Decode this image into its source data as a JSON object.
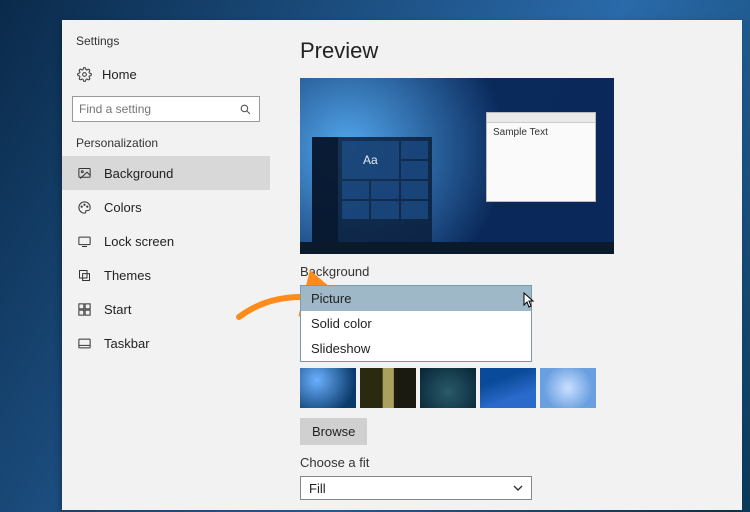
{
  "app_title": "Settings",
  "home_label": "Home",
  "search": {
    "placeholder": "Find a setting"
  },
  "section": "Personalization",
  "nav": [
    {
      "id": "background",
      "label": "Background",
      "selected": true
    },
    {
      "id": "colors",
      "label": "Colors",
      "selected": false
    },
    {
      "id": "lockscreen",
      "label": "Lock screen",
      "selected": false
    },
    {
      "id": "themes",
      "label": "Themes",
      "selected": false
    },
    {
      "id": "start",
      "label": "Start",
      "selected": false
    },
    {
      "id": "taskbar",
      "label": "Taskbar",
      "selected": false
    }
  ],
  "main": {
    "heading": "Preview",
    "sample_text": "Sample Text",
    "aa": "Aa",
    "background_label": "Background",
    "dropdown": {
      "options": [
        "Picture",
        "Solid color",
        "Slideshow"
      ],
      "highlighted": "Picture"
    },
    "browse_label": "Browse",
    "fit_label": "Choose a fit",
    "fit_value": "Fill"
  }
}
